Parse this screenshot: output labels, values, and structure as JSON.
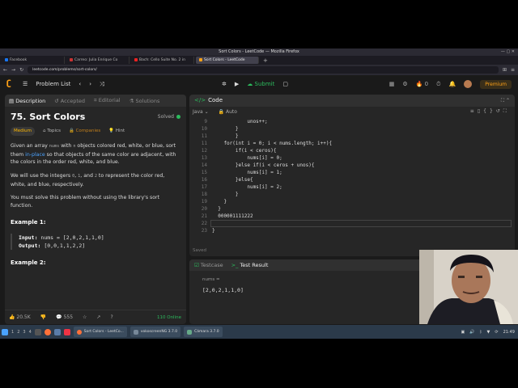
{
  "window": {
    "title": "Sort Colors - LeetCode — Mozilla Firefox"
  },
  "tabs": [
    {
      "label": "Facebook",
      "color": "#1877f2"
    },
    {
      "label": "Carreo: Julia Enrique Co",
      "color": "#cc3333"
    },
    {
      "label": "Bach: Cello Suite No. 2 in",
      "color": "#ee2222"
    },
    {
      "label": "Sort Colors - LeetCode",
      "color": "#ffa116"
    }
  ],
  "new_tab": "+",
  "address": {
    "url": "leetcode.com/problems/sort-colors/"
  },
  "lc": {
    "problem_list": "Problem List",
    "submit": "Submit",
    "premium": "Premium",
    "streak": "0"
  },
  "left": {
    "tabs": [
      "Description",
      "Accepted",
      "Editorial",
      "Solutions"
    ],
    "title": "75. Sort Colors",
    "solved": "Solved",
    "tags": {
      "difficulty": "Medium",
      "topics": "Topics",
      "companies": "Companies",
      "hint": "Hint"
    },
    "p1": {
      "a": "Given an array ",
      "code1": "nums",
      "b": " with ",
      "code2": "n",
      "c": " objects colored red, white, or blue, sort them ",
      "link": "in-place",
      "d": " so that objects of the same color are adjacent, with the colors in the order red, white, and blue."
    },
    "p2": {
      "a": "We will use the integers ",
      "c0": "0",
      "sep1": ", ",
      "c1": "1",
      "sep2": ", and ",
      "c2": "2",
      "b": " to represent the color red, white, and blue, respectively."
    },
    "p3": "You must solve this problem without using the library's sort function.",
    "example1": {
      "heading": "Example 1:",
      "input_label": "Input:",
      "input": "nums = [2,0,2,1,1,0]",
      "output_label": "Output:",
      "output": "[0,0,1,1,2,2]"
    },
    "example2": {
      "heading": "Example 2:"
    },
    "footer": {
      "likes": "20.5K",
      "comments": "555",
      "online": "110 Online"
    }
  },
  "code": {
    "header": "Code",
    "language": "Java",
    "mode": "Auto",
    "lines": [
      {
        "n": "9",
        "text": "            unos++;"
      },
      {
        "n": "10",
        "text": "        }"
      },
      {
        "n": "11",
        "text": "        }"
      },
      {
        "n": "11",
        "text": "    for(int i = 0; i < nums.length; i++){"
      },
      {
        "n": "12",
        "text": "        if(i < ceros){"
      },
      {
        "n": "13",
        "text": "            nums[i] = 0;"
      },
      {
        "n": "14",
        "text": "        }else if(i < ceros + unos){"
      },
      {
        "n": "15",
        "text": "            nums[i] = 1;"
      },
      {
        "n": "16",
        "text": "        }else{"
      },
      {
        "n": "17",
        "text": "            nums[i] = 2;"
      },
      {
        "n": "18",
        "text": "        }"
      },
      {
        "n": "19",
        "text": "    }"
      },
      {
        "n": "20",
        "text": "  }"
      },
      {
        "n": "21",
        "text": "  000001111222"
      },
      {
        "n": "22",
        "text": "  "
      },
      {
        "n": "23",
        "text": "}"
      }
    ],
    "saved": "Saved"
  },
  "test": {
    "tabs": [
      "Testcase",
      "Test Result"
    ],
    "var_label": "nums =",
    "value": "[2,0,2,1,1,0]"
  },
  "taskbar": {
    "workspaces": [
      "1",
      "2",
      "3",
      "4"
    ],
    "tasks": [
      "Sort Colors - LeetCo...",
      "vokoscreenNG 3.7.0",
      "Cámara 3.7.0"
    ],
    "time": "21:49"
  }
}
